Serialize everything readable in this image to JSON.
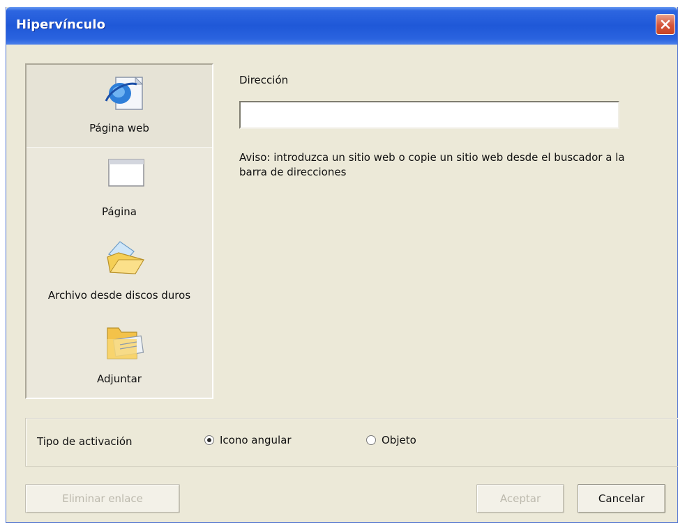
{
  "window": {
    "title": "Hipervínculo"
  },
  "sidebar": {
    "items": [
      {
        "label": "Página web",
        "icon": "web-page-icon",
        "selected": true
      },
      {
        "label": "Página",
        "icon": "page-icon",
        "selected": false
      },
      {
        "label": "Archivo desde discos duros",
        "icon": "folder-file-icon",
        "selected": false
      },
      {
        "label": "Adjuntar",
        "icon": "attach-folder-icon",
        "selected": false
      }
    ]
  },
  "main": {
    "address_label": "Dirección",
    "address_value": "",
    "hint": "Aviso: introduzca un sitio web o copie un sitio web desde el buscador a la barra de direcciones"
  },
  "activation": {
    "label": "Tipo de activación",
    "options": [
      {
        "label": "Icono angular",
        "checked": true
      },
      {
        "label": "Objeto",
        "checked": false
      }
    ]
  },
  "buttons": {
    "remove_link": "Eliminar enlace",
    "accept": "Aceptar",
    "cancel": "Cancelar"
  },
  "colors": {
    "titlebar": "#2458d8",
    "close": "#d4543a",
    "dialog_bg": "#ece9d8"
  }
}
